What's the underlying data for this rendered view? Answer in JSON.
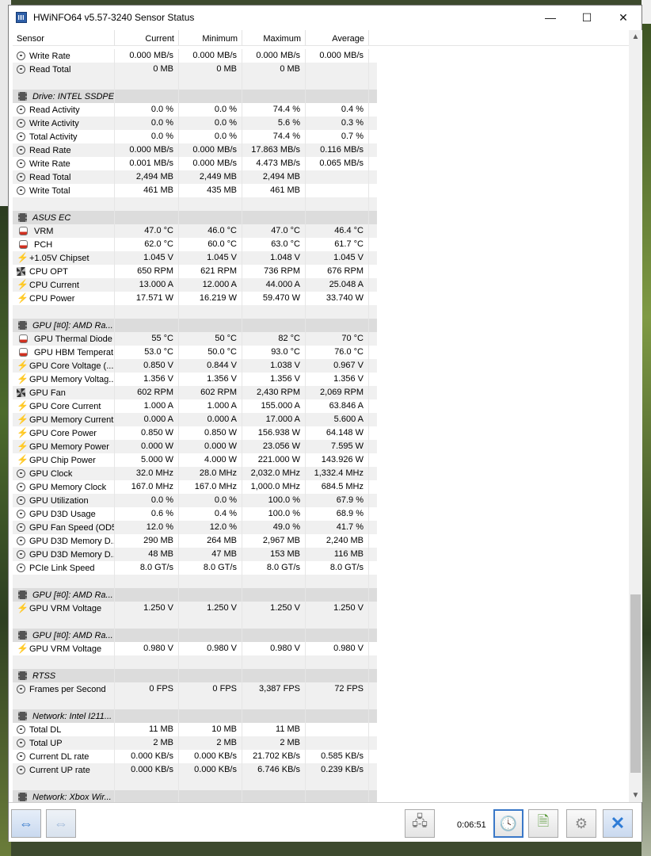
{
  "window": {
    "title": "HWiNFO64 v5.57-3240 Sensor Status"
  },
  "columns": [
    "Sensor",
    "Current",
    "Minimum",
    "Maximum",
    "Average"
  ],
  "rows": [
    {
      "type": "s",
      "icon": "clock",
      "name": "Write Rate",
      "cur": "0.000 MB/s",
      "min": "0.000 MB/s",
      "max": "0.000 MB/s",
      "avg": "0.000 MB/s"
    },
    {
      "type": "s",
      "icon": "clock",
      "name": "Read Total",
      "cur": "0 MB",
      "min": "0 MB",
      "max": "0 MB",
      "avg": ""
    },
    {
      "type": "blank"
    },
    {
      "type": "g",
      "name": "Drive: INTEL SSDPE..."
    },
    {
      "type": "s",
      "icon": "clock",
      "name": "Read Activity",
      "cur": "0.0 %",
      "min": "0.0 %",
      "max": "74.4 %",
      "avg": "0.4 %"
    },
    {
      "type": "s",
      "icon": "clock",
      "name": "Write Activity",
      "cur": "0.0 %",
      "min": "0.0 %",
      "max": "5.6 %",
      "avg": "0.3 %"
    },
    {
      "type": "s",
      "icon": "clock",
      "name": "Total Activity",
      "cur": "0.0 %",
      "min": "0.0 %",
      "max": "74.4 %",
      "avg": "0.7 %"
    },
    {
      "type": "s",
      "icon": "clock",
      "name": "Read Rate",
      "cur": "0.000 MB/s",
      "min": "0.000 MB/s",
      "max": "17.863 MB/s",
      "avg": "0.116 MB/s"
    },
    {
      "type": "s",
      "icon": "clock",
      "name": "Write Rate",
      "cur": "0.001 MB/s",
      "min": "0.000 MB/s",
      "max": "4.473 MB/s",
      "avg": "0.065 MB/s"
    },
    {
      "type": "s",
      "icon": "clock",
      "name": "Read Total",
      "cur": "2,494 MB",
      "min": "2,449 MB",
      "max": "2,494 MB",
      "avg": ""
    },
    {
      "type": "s",
      "icon": "clock",
      "name": "Write Total",
      "cur": "461 MB",
      "min": "435 MB",
      "max": "461 MB",
      "avg": ""
    },
    {
      "type": "blank"
    },
    {
      "type": "g",
      "name": "ASUS EC"
    },
    {
      "type": "s",
      "icon": "therm",
      "name": "VRM",
      "cur": "47.0 °C",
      "min": "46.0 °C",
      "max": "47.0 °C",
      "avg": "46.4 °C"
    },
    {
      "type": "s",
      "icon": "therm",
      "name": "PCH",
      "cur": "62.0 °C",
      "min": "60.0 °C",
      "max": "63.0 °C",
      "avg": "61.7 °C"
    },
    {
      "type": "s",
      "icon": "volt",
      "name": "+1.05V Chipset",
      "cur": "1.045 V",
      "min": "1.045 V",
      "max": "1.048 V",
      "avg": "1.045 V"
    },
    {
      "type": "s",
      "icon": "fan",
      "name": "CPU OPT",
      "cur": "650 RPM",
      "min": "621 RPM",
      "max": "736 RPM",
      "avg": "676 RPM"
    },
    {
      "type": "s",
      "icon": "volt",
      "name": "CPU Current",
      "cur": "13.000 A",
      "min": "12.000 A",
      "max": "44.000 A",
      "avg": "25.048 A"
    },
    {
      "type": "s",
      "icon": "volt",
      "name": "CPU Power",
      "cur": "17.571 W",
      "min": "16.219 W",
      "max": "59.470 W",
      "avg": "33.740 W"
    },
    {
      "type": "blank"
    },
    {
      "type": "g",
      "name": "GPU [#0]: AMD Ra..."
    },
    {
      "type": "s",
      "icon": "therm",
      "name": "GPU Thermal Diode",
      "cur": "55 °C",
      "min": "50 °C",
      "max": "82 °C",
      "avg": "70 °C"
    },
    {
      "type": "s",
      "icon": "therm",
      "name": "GPU HBM Temperat...",
      "cur": "53.0 °C",
      "min": "50.0 °C",
      "max": "93.0 °C",
      "avg": "76.0 °C"
    },
    {
      "type": "s",
      "icon": "volt",
      "name": "GPU Core Voltage (...",
      "cur": "0.850 V",
      "min": "0.844 V",
      "max": "1.038 V",
      "avg": "0.967 V"
    },
    {
      "type": "s",
      "icon": "volt",
      "name": "GPU Memory Voltag...",
      "cur": "1.356 V",
      "min": "1.356 V",
      "max": "1.356 V",
      "avg": "1.356 V"
    },
    {
      "type": "s",
      "icon": "fan",
      "name": "GPU Fan",
      "cur": "602 RPM",
      "min": "602 RPM",
      "max": "2,430 RPM",
      "avg": "2,069 RPM"
    },
    {
      "type": "s",
      "icon": "volt",
      "name": "GPU Core Current",
      "cur": "1.000 A",
      "min": "1.000 A",
      "max": "155.000 A",
      "avg": "63.846 A"
    },
    {
      "type": "s",
      "icon": "volt",
      "name": "GPU Memory Current",
      "cur": "0.000 A",
      "min": "0.000 A",
      "max": "17.000 A",
      "avg": "5.600 A"
    },
    {
      "type": "s",
      "icon": "volt",
      "name": "GPU Core Power",
      "cur": "0.850 W",
      "min": "0.850 W",
      "max": "156.938 W",
      "avg": "64.148 W"
    },
    {
      "type": "s",
      "icon": "volt",
      "name": "GPU Memory Power",
      "cur": "0.000 W",
      "min": "0.000 W",
      "max": "23.056 W",
      "avg": "7.595 W"
    },
    {
      "type": "s",
      "icon": "volt",
      "name": "GPU Chip Power",
      "cur": "5.000 W",
      "min": "4.000 W",
      "max": "221.000 W",
      "avg": "143.926 W"
    },
    {
      "type": "s",
      "icon": "clock",
      "name": "GPU Clock",
      "cur": "32.0 MHz",
      "min": "28.0 MHz",
      "max": "2,032.0 MHz",
      "avg": "1,332.4 MHz"
    },
    {
      "type": "s",
      "icon": "clock",
      "name": "GPU Memory Clock",
      "cur": "167.0 MHz",
      "min": "167.0 MHz",
      "max": "1,000.0 MHz",
      "avg": "684.5 MHz"
    },
    {
      "type": "s",
      "icon": "clock",
      "name": "GPU Utilization",
      "cur": "0.0 %",
      "min": "0.0 %",
      "max": "100.0 %",
      "avg": "67.9 %"
    },
    {
      "type": "s",
      "icon": "clock",
      "name": "GPU D3D Usage",
      "cur": "0.6 %",
      "min": "0.4 %",
      "max": "100.0 %",
      "avg": "68.9 %"
    },
    {
      "type": "s",
      "icon": "clock",
      "name": "GPU Fan Speed (OD5)",
      "cur": "12.0 %",
      "min": "12.0 %",
      "max": "49.0 %",
      "avg": "41.7 %"
    },
    {
      "type": "s",
      "icon": "clock",
      "name": "GPU D3D Memory D...",
      "cur": "290 MB",
      "min": "264 MB",
      "max": "2,967 MB",
      "avg": "2,240 MB"
    },
    {
      "type": "s",
      "icon": "clock",
      "name": "GPU D3D Memory D...",
      "cur": "48 MB",
      "min": "47 MB",
      "max": "153 MB",
      "avg": "116 MB"
    },
    {
      "type": "s",
      "icon": "clock",
      "name": "PCIe Link Speed",
      "cur": "8.0 GT/s",
      "min": "8.0 GT/s",
      "max": "8.0 GT/s",
      "avg": "8.0 GT/s"
    },
    {
      "type": "blank"
    },
    {
      "type": "g",
      "name": "GPU [#0]: AMD Ra..."
    },
    {
      "type": "s",
      "icon": "volt",
      "name": "GPU VRM Voltage",
      "cur": "1.250 V",
      "min": "1.250 V",
      "max": "1.250 V",
      "avg": "1.250 V"
    },
    {
      "type": "blank"
    },
    {
      "type": "g",
      "name": "GPU [#0]: AMD Ra..."
    },
    {
      "type": "s",
      "icon": "volt",
      "name": "GPU VRM Voltage",
      "cur": "0.980 V",
      "min": "0.980 V",
      "max": "0.980 V",
      "avg": "0.980 V"
    },
    {
      "type": "blank"
    },
    {
      "type": "g",
      "name": "RTSS"
    },
    {
      "type": "s",
      "icon": "clock",
      "name": "Frames per Second",
      "cur": "0 FPS",
      "min": "0 FPS",
      "max": "3,387 FPS",
      "avg": "72 FPS"
    },
    {
      "type": "blank"
    },
    {
      "type": "g",
      "name": "Network: Intel I211..."
    },
    {
      "type": "s",
      "icon": "clock",
      "name": "Total DL",
      "cur": "11 MB",
      "min": "10 MB",
      "max": "11 MB",
      "avg": ""
    },
    {
      "type": "s",
      "icon": "clock",
      "name": "Total UP",
      "cur": "2 MB",
      "min": "2 MB",
      "max": "2 MB",
      "avg": ""
    },
    {
      "type": "s",
      "icon": "clock",
      "name": "Current DL rate",
      "cur": "0.000 KB/s",
      "min": "0.000 KB/s",
      "max": "21.702 KB/s",
      "avg": "0.585 KB/s"
    },
    {
      "type": "s",
      "icon": "clock",
      "name": "Current UP rate",
      "cur": "0.000 KB/s",
      "min": "0.000 KB/s",
      "max": "6.746 KB/s",
      "avg": "0.239 KB/s"
    },
    {
      "type": "blank"
    },
    {
      "type": "g",
      "name": "Network: Xbox Wir..."
    }
  ],
  "footer": {
    "timer": "0:06:51"
  }
}
